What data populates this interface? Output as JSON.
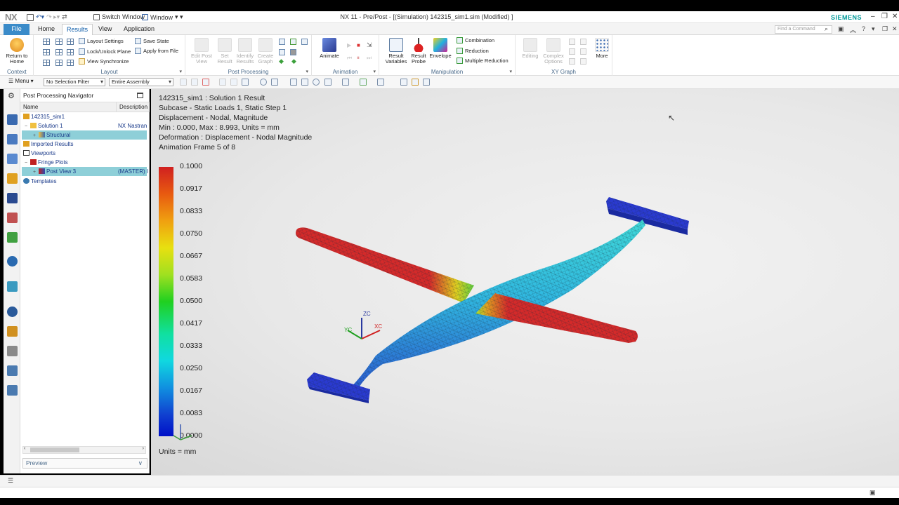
{
  "titlebar": {
    "logo": "NX",
    "switch_window": "Switch Window",
    "window_menu": "Window",
    "title": "NX 11 - Pre/Post - [(Simulation) 142315_sim1.sim (Modified) ]",
    "brand": "SIEMENS"
  },
  "menubar": {
    "file": "File",
    "tabs": [
      "Home",
      "Results",
      "View",
      "Application"
    ],
    "active_tab": "Results",
    "find_command_placeholder": "Find a Command"
  },
  "ribbon": {
    "context": {
      "btn": "Return to Home",
      "label": "Context"
    },
    "layout": {
      "items": [
        "Layout Settings",
        "Lock/Unlock Plane",
        "View Synchronize",
        "Save State",
        "Apply from File"
      ],
      "label": "Layout"
    },
    "post_processing": {
      "buttons": [
        "Edit Post View",
        "Set Result",
        "Identify Results",
        "Create Graph"
      ],
      "label": "Post Processing"
    },
    "animation": {
      "btn": "Animate",
      "label": "Animation"
    },
    "manipulation": {
      "buttons": [
        "Result Variables",
        "Result Probe",
        "Envelope"
      ],
      "items": [
        "Combination",
        "Reduction",
        "Multiple Reduction"
      ],
      "label": "Manipulation"
    },
    "xy_graph": {
      "buttons": [
        "Editing",
        "Complex Options"
      ],
      "more": "More",
      "label": "XY Graph"
    }
  },
  "toolbar": {
    "menu": "Menu",
    "selection_filter": "No Selection Filter",
    "assembly_filter": "Entire Assembly"
  },
  "navigator": {
    "title": "Post Processing Navigator",
    "columns": [
      "Name",
      "Description"
    ],
    "rows": [
      {
        "name": "142315_sim1",
        "desc": ""
      },
      {
        "name": "Solution 1",
        "desc": "NX Nastran"
      },
      {
        "name": "Structural",
        "desc": ""
      },
      {
        "name": "Imported Results",
        "desc": ""
      },
      {
        "name": "Viewports",
        "desc": ""
      },
      {
        "name": "Fringe Plots",
        "desc": ""
      },
      {
        "name": "Post View 3",
        "desc": "(MASTER) I"
      },
      {
        "name": "Templates",
        "desc": ""
      }
    ],
    "preview": "Preview"
  },
  "viewport": {
    "info": [
      "142315_sim1 : Solution 1 Result",
      "Subcase - Static Loads 1, Static Step 1",
      "Displacement - Nodal, Magnitude",
      "Min : 0.000, Max : 8.993, Units = mm",
      "Deformation : Displacement - Nodal Magnitude",
      "Animation Frame 5 of 8"
    ],
    "legend": [
      "0.1000",
      "0.0917",
      "0.0833",
      "0.0750",
      "0.0667",
      "0.0583",
      "0.0500",
      "0.0417",
      "0.0333",
      "0.0250",
      "0.0167",
      "0.0083",
      "0.0000"
    ],
    "units": "Units = mm",
    "triad": {
      "z": "ZC",
      "y": "YC",
      "x": "XC"
    }
  },
  "colors": {
    "accent": "#3a8bc9",
    "brand": "#009999",
    "highlight_row": "#8ecfd8",
    "mesh_red": "#d42a2a",
    "mesh_blue": "#2a3ad0",
    "mesh_cyan": "#30c0d8"
  }
}
